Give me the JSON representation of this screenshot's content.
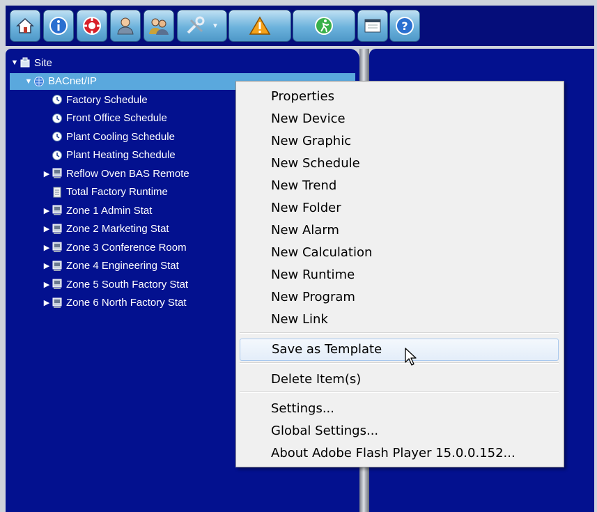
{
  "toolbar": {
    "buttons": [
      {
        "icon": "home-icon"
      },
      {
        "icon": "info-icon"
      },
      {
        "icon": "lifebuoy-icon"
      },
      {
        "icon": "user-icon"
      },
      {
        "icon": "users-icon"
      },
      {
        "icon": "tools-icon"
      },
      {
        "icon": "warning-icon"
      },
      {
        "icon": "runner-icon"
      },
      {
        "icon": "window-icon"
      },
      {
        "icon": "help-icon"
      }
    ]
  },
  "tree": {
    "items": [
      {
        "label": "Site",
        "expander": "expanded",
        "icon": "site-icon",
        "level": 0
      },
      {
        "label": "BACnet/IP",
        "expander": "expanded",
        "icon": "globe-icon",
        "level": 1,
        "selected": true
      },
      {
        "label": "Factory Schedule",
        "expander": "none",
        "icon": "clock-icon",
        "level": 2
      },
      {
        "label": "Front Office Schedule",
        "expander": "none",
        "icon": "clock-icon",
        "level": 2
      },
      {
        "label": "Plant Cooling Schedule",
        "expander": "none",
        "icon": "clock-icon",
        "level": 2
      },
      {
        "label": "Plant Heating Schedule",
        "expander": "none",
        "icon": "clock-icon",
        "level": 2
      },
      {
        "label": "Reflow Oven BAS Remote",
        "expander": "collapsed",
        "icon": "device-icon",
        "level": 2
      },
      {
        "label": "Total Factory Runtime",
        "expander": "none",
        "icon": "document-icon",
        "level": 2
      },
      {
        "label": "Zone 1 Admin Stat",
        "expander": "collapsed",
        "icon": "device-icon",
        "level": 2
      },
      {
        "label": "Zone 2 Marketing Stat",
        "expander": "collapsed",
        "icon": "device-icon",
        "level": 2
      },
      {
        "label": "Zone 3 Conference Room",
        "expander": "collapsed",
        "icon": "device-icon",
        "level": 2
      },
      {
        "label": "Zone 4 Engineering Stat",
        "expander": "collapsed",
        "icon": "device-icon",
        "level": 2
      },
      {
        "label": "Zone 5 South Factory Stat",
        "expander": "collapsed",
        "icon": "device-icon",
        "level": 2
      },
      {
        "label": "Zone 6 North Factory Stat",
        "expander": "collapsed",
        "icon": "device-icon",
        "level": 2
      }
    ]
  },
  "context_menu": {
    "items": [
      {
        "label": "Properties"
      },
      {
        "label": "New Device"
      },
      {
        "label": "New Graphic"
      },
      {
        "label": "New Schedule"
      },
      {
        "label": "New Trend"
      },
      {
        "label": "New Folder"
      },
      {
        "label": "New Alarm"
      },
      {
        "label": "New Calculation"
      },
      {
        "label": "New Runtime"
      },
      {
        "label": "New Program"
      },
      {
        "label": "New Link"
      },
      {
        "label": "Save as Template",
        "hovered": true
      },
      {
        "label": "Delete Item(s)"
      },
      {
        "label": "Settings..."
      },
      {
        "label": "Global Settings..."
      },
      {
        "label": "About Adobe Flash Player 15.0.0.152..."
      }
    ]
  },
  "colors": {
    "panel_bg": "#03118f",
    "selection": "#5aa8dd",
    "toolbar_bg": "#050d7a"
  }
}
